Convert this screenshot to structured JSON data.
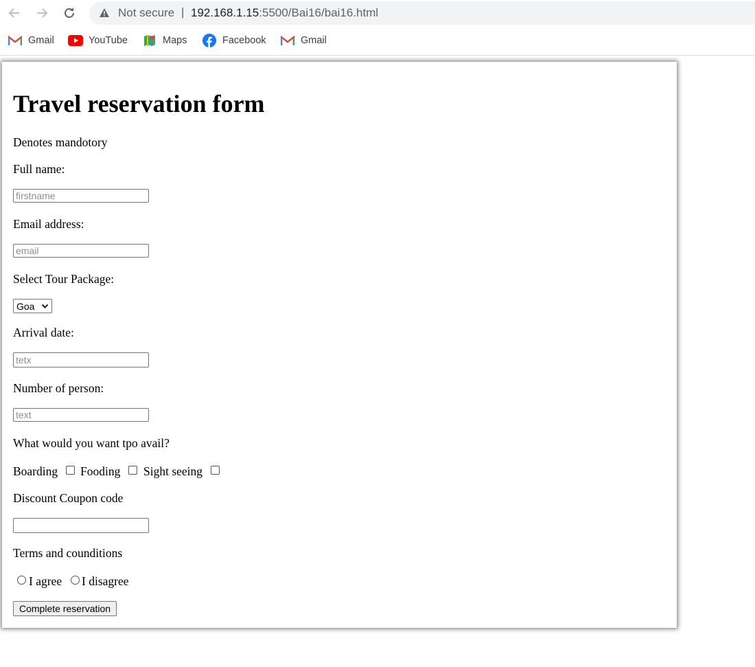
{
  "browser": {
    "security_label": "Not secure",
    "separator": "|",
    "url_host": "192.168.1.15",
    "url_rest": ":5500/Bai16/bai16.html"
  },
  "bookmarks": [
    {
      "label": "Gmail",
      "icon": "gmail-icon"
    },
    {
      "label": "YouTube",
      "icon": "youtube-icon"
    },
    {
      "label": "Maps",
      "icon": "maps-icon"
    },
    {
      "label": "Facebook",
      "icon": "facebook-icon"
    },
    {
      "label": "Gmail",
      "icon": "gmail-icon"
    }
  ],
  "form": {
    "title": "Travel reservation form",
    "mandatory_note": "Denotes mandotory",
    "full_name_label": "Full name:",
    "full_name_placeholder": "firstname",
    "email_label": "Email address:",
    "email_placeholder": "email",
    "tour_label": "Select Tour Package:",
    "tour_selected": "Goa",
    "arrival_label": "Arrival date:",
    "arrival_placeholder": "tetx",
    "persons_label": "Number of person:",
    "persons_placeholder": "text",
    "avail_label": "What would you want tpo avail?",
    "options": [
      "Boarding",
      "Fooding",
      "Sight seeing"
    ],
    "coupon_label": "Discount Coupon code",
    "coupon_value": "",
    "terms_label": "Terms and counditions",
    "agree_label": "I agree",
    "disagree_label": "I disagree",
    "submit_label": "Complete reservation"
  }
}
